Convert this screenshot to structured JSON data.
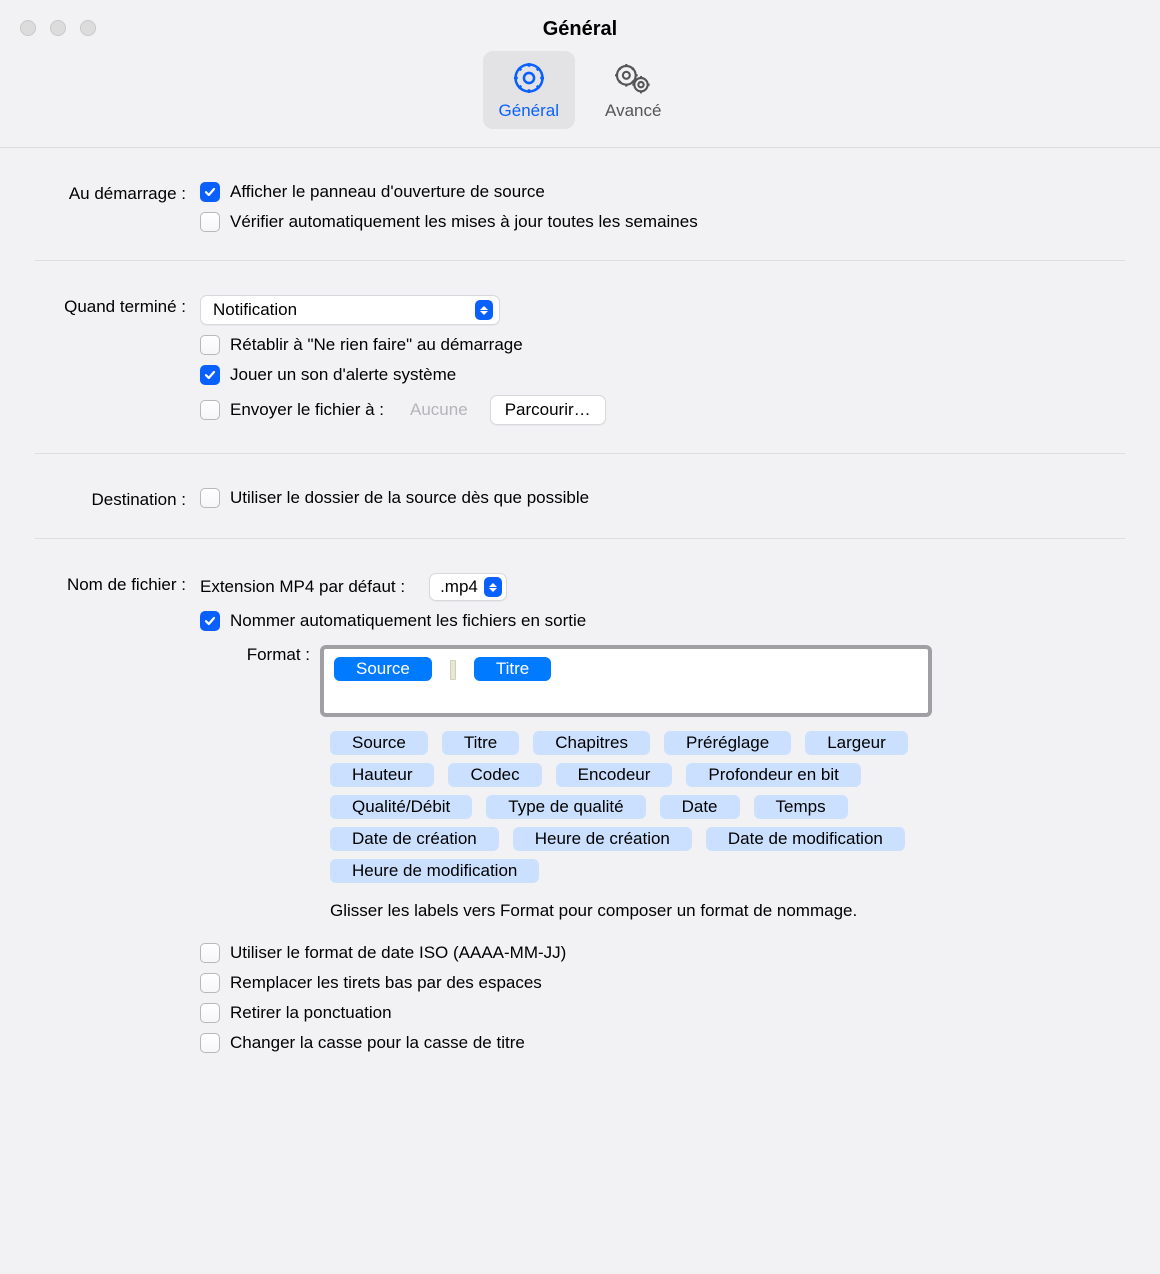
{
  "window": {
    "title": "Général"
  },
  "tabs": {
    "general": "Général",
    "advanced": "Avancé"
  },
  "startup": {
    "label": "Au démarrage :",
    "opt1": "Afficher le panneau d'ouverture de source",
    "opt2": "Vérifier automatiquement les mises à jour toutes les semaines"
  },
  "whenDone": {
    "label": "Quand terminé :",
    "select": "Notification",
    "reset": "Rétablir à \"Ne rien faire\" au démarrage",
    "sound": "Jouer un son d'alerte système",
    "sendLabel": "Envoyer le fichier à :",
    "sendValue": "Aucune",
    "browse": "Parcourir…"
  },
  "dest": {
    "label": "Destination :",
    "useSource": "Utiliser le dossier de la source dès que possible"
  },
  "filename": {
    "label": "Nom de fichier :",
    "extLabel": "Extension MP4 par défaut :",
    "extValue": ".mp4",
    "autoName": "Nommer automatiquement les fichiers en sortie",
    "formatLabel": "Format :",
    "activeTokens": [
      "Source",
      "Titre"
    ],
    "tokens": [
      "Source",
      "Titre",
      "Chapitres",
      "Préréglage",
      "Largeur",
      "Hauteur",
      "Codec",
      "Encodeur",
      "Profondeur en bit",
      "Qualité/Débit",
      "Type de qualité",
      "Date",
      "Temps",
      "Date de création",
      "Heure de création",
      "Date de modification",
      "Heure de modification"
    ],
    "hint": "Glisser les labels vers Format pour composer un format de nommage.",
    "iso": "Utiliser le format de date ISO (AAAA-MM-JJ)",
    "underscore": "Remplacer les tirets bas par des espaces",
    "punct": "Retirer la ponctuation",
    "titlecase": "Changer la casse pour la casse de titre"
  }
}
